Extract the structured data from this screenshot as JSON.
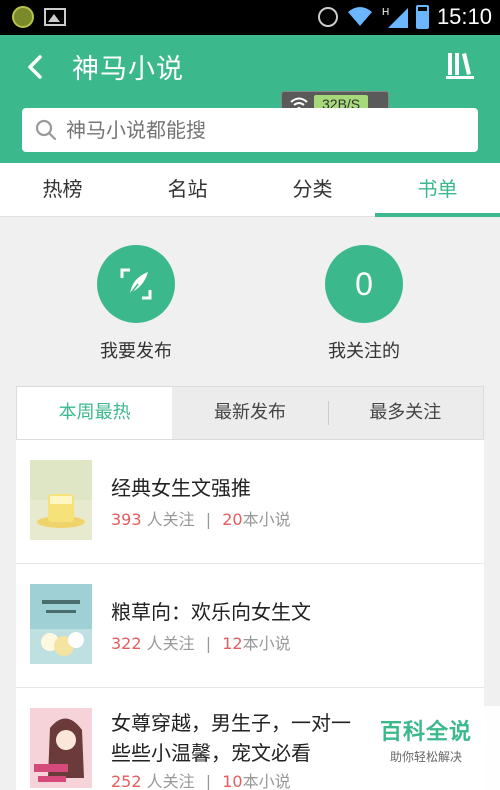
{
  "status_bar": {
    "time": "15:10",
    "network_type": "H"
  },
  "header": {
    "title": "神马小说",
    "speed": "32B/S",
    "search_placeholder": "神马小说都能搜"
  },
  "tabs": [
    {
      "label": "热榜"
    },
    {
      "label": "名站"
    },
    {
      "label": "分类"
    },
    {
      "label": "书单",
      "active": true
    }
  ],
  "actions": {
    "publish_label": "我要发布",
    "following_count": "0",
    "following_label": "我关注的"
  },
  "sub_tabs": [
    {
      "label": "本周最热",
      "active": true
    },
    {
      "label": "最新发布"
    },
    {
      "label": "最多关注"
    }
  ],
  "booklists": [
    {
      "title": "经典女生文强推",
      "followers": "393",
      "followers_suffix": "人关注",
      "count": "20",
      "count_suffix": "本小说"
    },
    {
      "title": "粮草向：欢乐向女生文",
      "followers": "322",
      "followers_suffix": "人关注",
      "count": "12",
      "count_suffix": "本小说"
    },
    {
      "title": "女尊穿越，男生子，一对一些些小温馨，宠文必看",
      "followers": "252",
      "followers_suffix": "人关注",
      "count": "10",
      "count_suffix": "本小说"
    }
  ],
  "watermark": {
    "title": "百科全说",
    "subtitle": "助你轻松解决"
  },
  "colors": {
    "accent": "#3cb98c",
    "highlight": "#e65c5c"
  }
}
